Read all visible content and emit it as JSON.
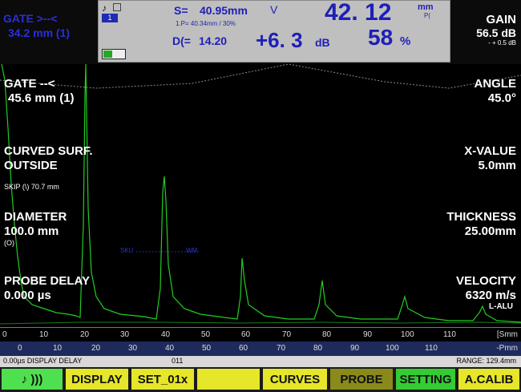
{
  "header": {
    "gate_tl_label": "GATE >--<",
    "gate_tl_value": "34.2 mm (1)",
    "s_label": "S=",
    "s_value": "40.95mm",
    "v_mark": "V",
    "ip_text": "1.P= 40.34mm / 30%",
    "d_label": "D(=",
    "d_value": "14.20",
    "main_value": "42. 12",
    "main_unit": "mm",
    "main_unit_sub": "P(",
    "db_value": "+6. 3",
    "db_unit": "dB",
    "percent_value": "58",
    "percent_unit": "%",
    "gain_label": "GAIN",
    "gain_value": "56.5 dB",
    "gain_step": "- + 0.5 dB",
    "channel_num": "1"
  },
  "left_labels": {
    "gate_label": "GATE --<",
    "gate_value": "45.6 mm (1)",
    "curved_surf": "CURVED SURF.",
    "outside": "OUTSIDE",
    "skip": "SKIP (\\) 70.7 mm",
    "diameter_label": "DIAMETER",
    "diameter_value": "100.0 mm",
    "diameter_sub": "(O)",
    "probe_delay_label": "PROBE DELAY",
    "probe_delay_value": "0.000 µs"
  },
  "right_labels": {
    "angle_label": "ANGLE",
    "angle_value": "45.0°",
    "xvalue_label": "X-VALUE",
    "xvalue_value": "5.0mm",
    "thickness_label": "THICKNESS",
    "thickness_value": "25.00mm",
    "velocity_label": "VELOCITY",
    "velocity_value": "6320 m/s",
    "material": "L-ALU"
  },
  "marker_left": "SKU",
  "marker_right": "WM",
  "scale_top": [
    "0",
    "10",
    "20",
    "30",
    "40",
    "50",
    "60",
    "70",
    "80",
    "90",
    "100",
    "110"
  ],
  "scale_top_unit": "[Smm",
  "scale_bottom": [
    "0",
    "10",
    "20",
    "30",
    "40",
    "50",
    "60",
    "70",
    "80",
    "90",
    "100",
    "110"
  ],
  "scale_bottom_unit": "-Pmm",
  "status": {
    "left": "0.00µs DISPLAY DELAY",
    "center": "011",
    "right": "RANGE: 129.4mm"
  },
  "buttons": {
    "sound": "♪ )))",
    "display": "DISPLAY",
    "set": "SET_01x",
    "blank": "",
    "curves": "CURVES",
    "probe": "PROBE",
    "setting": "SETTING",
    "acalib": "A.CALIB"
  },
  "colors": {
    "trace": "#22cc22",
    "button_yellow": "#e6e62a",
    "button_green": "#33cc33",
    "button_olive": "#8a8a1a",
    "header_blue": "#1f1fb8"
  }
}
